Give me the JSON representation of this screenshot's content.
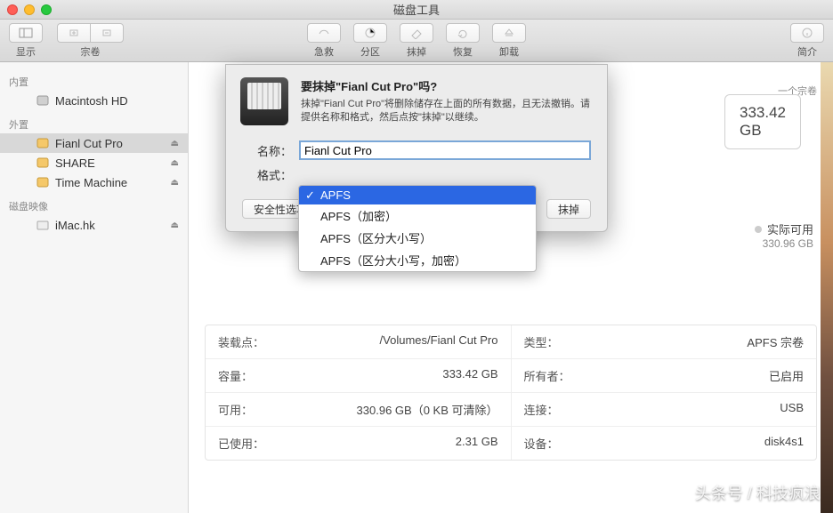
{
  "window": {
    "title": "磁盘工具"
  },
  "toolbar": {
    "left": {
      "view": "显示",
      "volume": "宗卷"
    },
    "center": [
      {
        "label": "急救"
      },
      {
        "label": "分区"
      },
      {
        "label": "抹掉"
      },
      {
        "label": "恢复"
      },
      {
        "label": "卸载"
      }
    ],
    "right": {
      "info": "简介"
    }
  },
  "sidebar": {
    "sections": [
      {
        "head": "内置",
        "items": [
          {
            "name": "Macintosh HD",
            "eject": false
          }
        ]
      },
      {
        "head": "外置",
        "items": [
          {
            "name": "Fianl Cut Pro",
            "eject": true,
            "selected": true
          },
          {
            "name": "SHARE",
            "eject": true
          },
          {
            "name": "Time Machine",
            "eject": true
          }
        ]
      },
      {
        "head": "磁盘映像",
        "items": [
          {
            "name": "iMac.hk",
            "eject": true
          }
        ]
      }
    ]
  },
  "summary": {
    "size": "333.42 GB",
    "sub": "一个宗卷",
    "actual_label": "实际可用",
    "actual_value": "330.96 GB"
  },
  "dialog": {
    "heading": "要抹掉\"Fianl Cut Pro\"吗?",
    "message": "抹掉\"Fianl Cut Pro\"将删除储存在上面的所有数据，且无法撤销。请提供名称和格式，然后点按\"抹掉\"以继续。",
    "name_label": "名称：",
    "name_value": "Fianl Cut Pro",
    "format_label": "格式：",
    "security_btn": "安全性选项",
    "erase_btn": "抹掉"
  },
  "dropdown": {
    "items": [
      {
        "label": "APFS",
        "selected": true
      },
      {
        "label": "APFS（加密）"
      },
      {
        "label": "APFS（区分大小写）"
      },
      {
        "label": "APFS（区分大小写，加密）"
      }
    ]
  },
  "details": {
    "rows": [
      {
        "k1": "装载点：",
        "v1": "/Volumes/Fianl Cut Pro",
        "k2": "类型：",
        "v2": "APFS 宗卷"
      },
      {
        "k1": "容量：",
        "v1": "333.42 GB",
        "k2": "所有者：",
        "v2": "已启用"
      },
      {
        "k1": "可用：",
        "v1": "330.96 GB（0 KB 可清除）",
        "k2": "连接：",
        "v2": "USB"
      },
      {
        "k1": "已使用：",
        "v1": "2.31 GB",
        "k2": "设备：",
        "v2": "disk4s1"
      }
    ]
  },
  "watermark": "头条号 / 科技疯浪"
}
